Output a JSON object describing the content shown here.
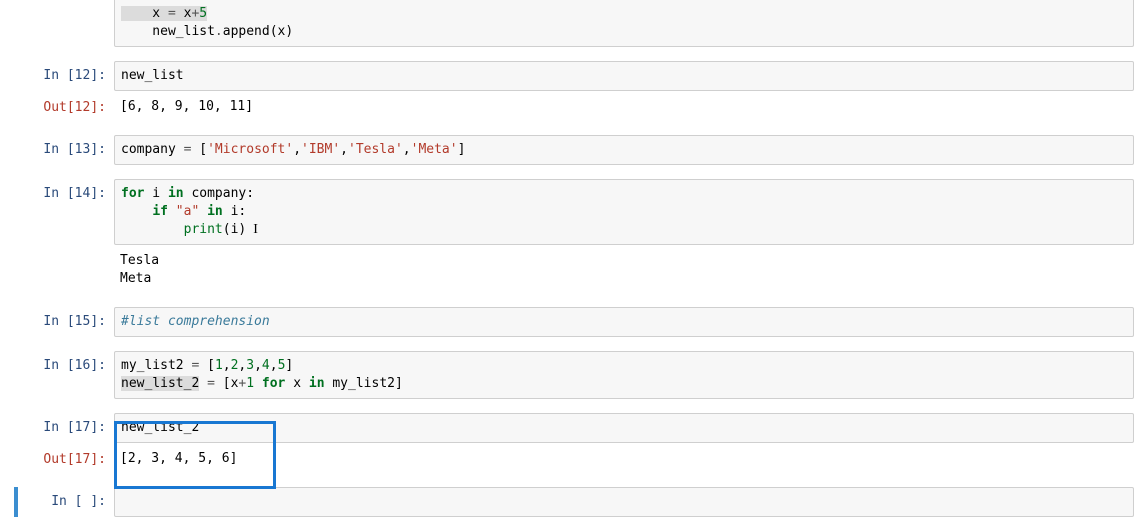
{
  "cells": {
    "c0": {
      "prompt": "",
      "line1_pre": "    x ",
      "line1_eq": "=",
      "line1_post": " x",
      "line1_plus": "+",
      "line1_five": "5",
      "line2_pre": "    new_list",
      "line2_dot": ".",
      "line2_call": "append(x)"
    },
    "c12_in": {
      "prompt": "In [12]:",
      "code": "new_list"
    },
    "c12_out": {
      "prompt": "Out[12]:",
      "text": "[6, 8, 9, 10, 11]"
    },
    "c13_in": {
      "prompt": "In [13]:",
      "var": "company ",
      "eq": "=",
      "sp": " [",
      "s1": "'Microsoft'",
      "c1": ",",
      "s2": "'IBM'",
      "c2": ",",
      "s3": "'Tesla'",
      "c3": ",",
      "s4": "'Meta'",
      "end": "]"
    },
    "c14_in": {
      "prompt": "In [14]:",
      "kw_for": "for",
      "sp1": " i ",
      "kw_in": "in",
      "sp2": " company:",
      "l2_indent": "    ",
      "kw_if": "if",
      "sp3": " ",
      "str_a": "\"a\"",
      "sp4": " ",
      "kw_in2": "in",
      "sp5": " i:",
      "l3_indent": "        ",
      "print": "print",
      "l3_call": "(i)",
      "cursor": "  I"
    },
    "c14_out": {
      "text": "Tesla\nMeta"
    },
    "c15_in": {
      "prompt": "In [15]:",
      "comment": "#list comprehension"
    },
    "c16_in": {
      "prompt": "In [16]:",
      "l1_var": "my_list2 ",
      "l1_eq": "=",
      "l1_sp": " [",
      "n1": "1",
      "c1": ",",
      "n2": "2",
      "c2": ",",
      "n3": "3",
      "c3": ",",
      "n4": "4",
      "c4": ",",
      "n5": "5",
      "l1_end": "]",
      "l2_var": "new_list_2",
      "l2_sp1": " ",
      "l2_eq": "=",
      "l2_sp2": " [x",
      "l2_plus": "+",
      "l2_one": "1",
      "l2_sp3": " ",
      "kw_for": "for",
      "l2_sp4": " x ",
      "kw_in": "in",
      "l2_sp5": " my_list2]"
    },
    "c17_in": {
      "prompt": "In [17]:",
      "code": "new_list_2"
    },
    "c17_out": {
      "prompt": "Out[17]:",
      "text": "[2, 3, 4, 5, 6]"
    },
    "c_empty": {
      "prompt": "In [ ]:",
      "code": " "
    }
  }
}
